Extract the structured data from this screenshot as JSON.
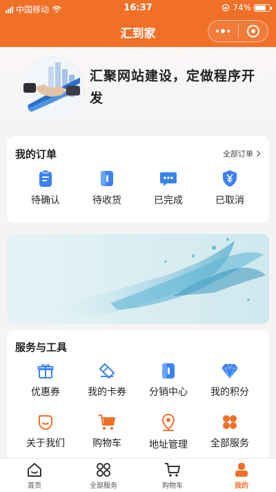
{
  "status_bar": {
    "carrier": "中国移动",
    "time": "16:37",
    "battery": "74%",
    "battery_level": 0.74
  },
  "nav": {
    "title": "汇到家"
  },
  "profile": {
    "slogan": "汇聚网站建设，定做程序开发"
  },
  "orders": {
    "title": "我的订单",
    "all_label": "全部订单",
    "items": [
      {
        "label": "待确认",
        "icon": "clipboard-icon"
      },
      {
        "label": "待收货",
        "icon": "package-icon"
      },
      {
        "label": "已完成",
        "icon": "chat-bubble-icon"
      },
      {
        "label": "已取消",
        "icon": "yen-shield-icon"
      }
    ]
  },
  "tools": {
    "title": "服务与工具",
    "items": [
      {
        "label": "优惠券",
        "icon": "gift-icon"
      },
      {
        "label": "我的卡券",
        "icon": "ticket-icon"
      },
      {
        "label": "分销中心",
        "icon": "distribution-icon"
      },
      {
        "label": "我的积分",
        "icon": "diamond-icon"
      },
      {
        "label": "关于我们",
        "icon": "smile-icon"
      },
      {
        "label": "购物车",
        "icon": "cart-icon"
      },
      {
        "label": "地址管理",
        "icon": "location-pin-icon"
      },
      {
        "label": "全部服务",
        "icon": "grid-icon"
      }
    ]
  },
  "tabbar": {
    "items": [
      {
        "label": "首页",
        "icon": "home-icon"
      },
      {
        "label": "全部服务",
        "icon": "services-icon"
      },
      {
        "label": "购物车",
        "icon": "cart-icon"
      },
      {
        "label": "我的",
        "icon": "user-icon"
      }
    ],
    "active": "我的"
  },
  "colors": {
    "brand": "#f07028",
    "icon_blue": "#3b82f0",
    "icon_orange": "#f07028"
  }
}
